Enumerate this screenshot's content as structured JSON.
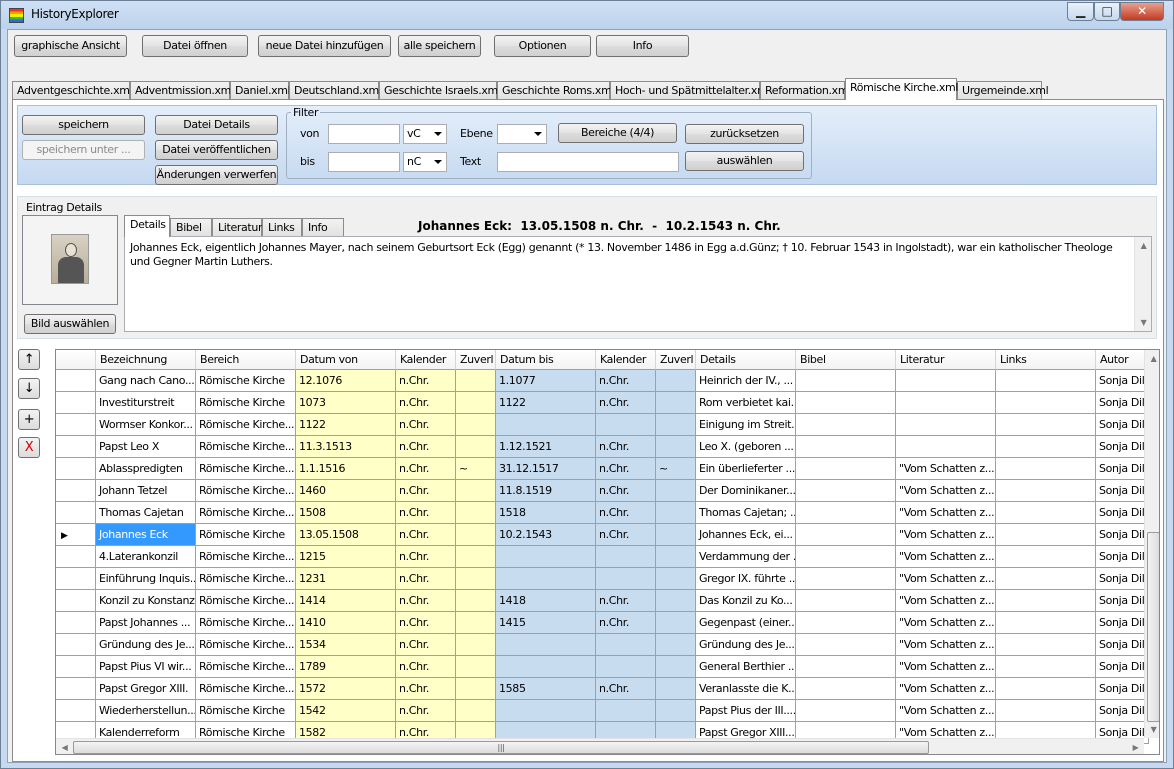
{
  "window": {
    "title": "HistoryExplorer",
    "minimize": "▁",
    "maximize": "□",
    "close": "✕"
  },
  "toolbar": {
    "graphische": "graphische Ansicht",
    "oeffnen": "Datei öffnen",
    "hinzufuegen": "neue Datei hinzufügen",
    "alle_speichern": "alle speichern",
    "optionen": "Optionen",
    "info": "Info"
  },
  "tabs": [
    "Adventgeschichte.xml",
    "Adventmission.xml",
    "Daniel.xml",
    "Deutschland.xml",
    "Geschichte Israels.xml",
    "Geschichte Roms.xml",
    "Hoch- und Spätmittelalter.xml",
    "Reformation.xml",
    "Römische Kirche.xml",
    "Urgemeinde.xml"
  ],
  "selected_tab": "Römische Kirche.xml",
  "actions": {
    "speichern": "speichern",
    "speichern_unter": "speichern unter ...",
    "datei_details": "Datei Details",
    "datei_veroeffentlichen": "Datei veröffentlichen",
    "aenderungen_verwerfen": "Änderungen verwerfen"
  },
  "filter": {
    "legend": "Filter",
    "von": "von",
    "bis": "bis",
    "von_era": "vC",
    "bis_era": "nC",
    "ebene": "Ebene",
    "text": "Text",
    "bereiche": "Bereiche (4/4)",
    "zuruecksetzen": "zurücksetzen",
    "auswaehlen": "auswählen"
  },
  "details": {
    "legend": "Eintrag Details",
    "bild_auswaehlen": "Bild auswählen",
    "tabs": [
      "Details",
      "Bibel",
      "Literatur",
      "Links",
      "Info"
    ],
    "entry_title": "Johannes Eck:  13.05.1508 n. Chr.  -  10.2.1543 n. Chr.",
    "text": "Johannes Eck, eigentlich Johannes Mayer, nach seinem Geburtsort Eck (Egg) genannt (* 13. November 1486 in Egg a.d.Günz; † 10. Februar 1543 in Ingolstadt), war ein katholischer Theologe und Gegner Martin Luthers."
  },
  "nav": {
    "up": "↑",
    "down": "↓",
    "add": "+",
    "delete": "X"
  },
  "columns": [
    "Bezeichnung",
    "Bereich",
    "Datum von",
    "Kalender",
    "Zuverl",
    "Datum bis",
    "Kalender",
    "Zuverl",
    "Details",
    "Bibel",
    "Literatur",
    "Links",
    "Autor"
  ],
  "rows": [
    [
      "Gang nach Cano...",
      "Römische Kirche",
      "12.1076",
      "n.Chr.",
      "",
      "1.1077",
      "n.Chr.",
      "",
      "Heinrich der IV., ...",
      "",
      "",
      "",
      "Sonja Dilly"
    ],
    [
      "Investiturstreit",
      "Römische Kirche",
      "1073",
      "n.Chr.",
      "",
      "1122",
      "n.Chr.",
      "",
      "Rom verbietet kai...",
      "",
      "",
      "",
      "Sonja Dilly"
    ],
    [
      "Wormser Konkor...",
      "Römische Kirche....",
      "1122",
      "n.Chr.",
      "",
      "",
      "",
      "",
      "Einigung im Streit...",
      "",
      "",
      "",
      "Sonja Dilly"
    ],
    [
      "Papst Leo X",
      "Römische Kirche....",
      "11.3.1513",
      "n.Chr.",
      "",
      "1.12.1521",
      "n.Chr.",
      "",
      "Leo X. (geboren ...",
      "",
      "",
      "",
      "Sonja Dilly"
    ],
    [
      "Ablasspredigten",
      "Römische Kirche....",
      "1.1.1516",
      "n.Chr.",
      "~",
      "31.12.1517",
      "n.Chr.",
      "~",
      "Ein überlieferter ...",
      "",
      "\"Vom Schatten z...",
      "",
      "Sonja Dilly"
    ],
    [
      "Johann Tetzel",
      "Römische Kirche....",
      "1460",
      "n.Chr.",
      "",
      "11.8.1519",
      "n.Chr.",
      "",
      "Der Dominikaner...",
      "",
      "\"Vom Schatten z...",
      "",
      "Sonja Dilly"
    ],
    [
      "Thomas Cajetan",
      "Römische Kirche....",
      "1508",
      "n.Chr.",
      "",
      "1518",
      "n.Chr.",
      "",
      "Thomas Cajetan; ...",
      "",
      "\"Vom Schatten z...",
      "",
      "Sonja Dilly"
    ],
    [
      "Johannes Eck",
      "Römische Kirche",
      "13.05.1508",
      "n.Chr.",
      "",
      "10.2.1543",
      "n.Chr.",
      "",
      "Johannes Eck, ei...",
      "",
      "\"Vom Schatten z...",
      "",
      "Sonja Dilly"
    ],
    [
      "4.Laterankonzil",
      "Römische Kirche....",
      "1215",
      "n.Chr.",
      "",
      "",
      "",
      "",
      "Verdammung der ...",
      "",
      "\"Vom Schatten z...",
      "",
      "Sonja Dilly"
    ],
    [
      "Einführung Inquis...",
      "Römische Kirche....",
      "1231",
      "n.Chr.",
      "",
      "",
      "",
      "",
      "Gregor IX. führte ...",
      "",
      "\"Vom Schatten z...",
      "",
      "Sonja Dilly"
    ],
    [
      "Konzil zu Konstanz",
      "Römische Kirche....",
      "1414",
      "n.Chr.",
      "",
      "1418",
      "n.Chr.",
      "",
      "Das Konzil zu Ko...",
      "",
      "\"Vom Schatten z...",
      "",
      "Sonja Dilly"
    ],
    [
      "Papst Johannes ...",
      "Römische Kirche....",
      "1410",
      "n.Chr.",
      "",
      "1415",
      "n.Chr.",
      "",
      "Gegenpast (einer...",
      "",
      "\"Vom Schatten z...",
      "",
      "Sonja Dilly"
    ],
    [
      "Gründung des Je...",
      "Römische Kirche....",
      "1534",
      "n.Chr.",
      "",
      "",
      "",
      "",
      "Gründung des Je...",
      "",
      "\"Vom Schatten z...",
      "",
      "Sonja Dilly"
    ],
    [
      "Papst Pius VI wir...",
      "Römische Kirche....",
      "1789",
      "n.Chr.",
      "",
      "",
      "",
      "",
      "General Berthier ...",
      "",
      "\"Vom Schatten z...",
      "",
      "Sonja Dilly"
    ],
    [
      "Papst Gregor XIII.",
      "Römische Kirche....",
      "1572",
      "n.Chr.",
      "",
      "1585",
      "n.Chr.",
      "",
      "Veranlasste die K...",
      "",
      "\"Vom Schatten z...",
      "",
      "Sonja Dilly"
    ],
    [
      "Wiederherstellun...",
      "Römische Kirche",
      "1542",
      "n.Chr.",
      "",
      "",
      "",
      "",
      "Papst Pius der III....",
      "",
      "\"Vom Schatten z...",
      "",
      "Sonja Dilly"
    ],
    [
      "Kalenderreform",
      "Römische Kirche",
      "1582",
      "n.Chr.",
      "",
      "",
      "",
      "",
      "Papst Gregor XIII....",
      "",
      "\"Vom Schatten z...",
      "",
      "Sonja Dilly"
    ]
  ],
  "current_row_index": 7,
  "current_row_marker": "▶",
  "colors": {
    "date_from_bg": "#ffffc8",
    "date_to_bg": "#c8dcf0",
    "selection": "#3399ff"
  }
}
